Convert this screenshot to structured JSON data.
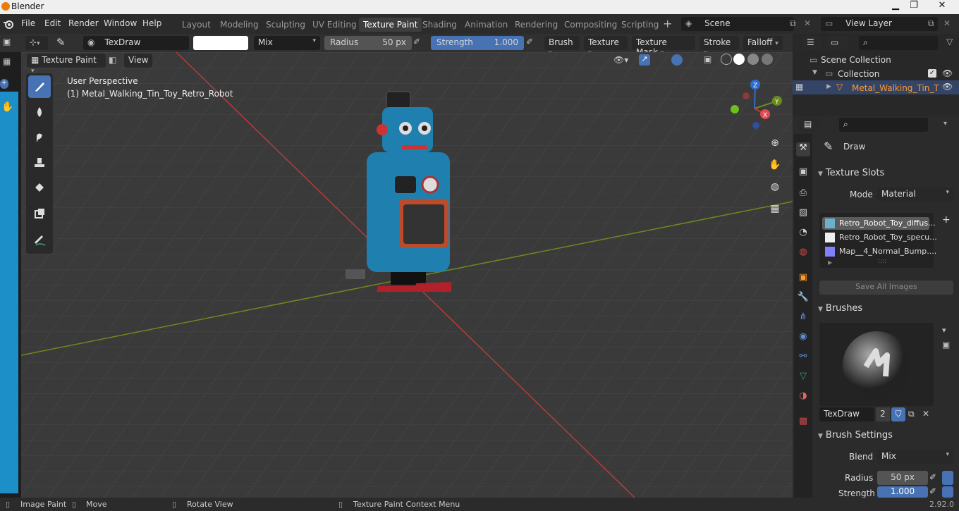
{
  "window": {
    "title": "Blender",
    "minimize": "▁",
    "maximize": "❐",
    "close": "✕"
  },
  "menu": [
    "File",
    "Edit",
    "Render",
    "Window",
    "Help"
  ],
  "workspaces": [
    "Layout",
    "Modeling",
    "Sculpting",
    "UV Editing",
    "Texture Paint",
    "Shading",
    "Animation",
    "Rendering",
    "Compositing",
    "Scripting"
  ],
  "active_workspace": "Texture Paint",
  "scene": {
    "name": "Scene",
    "view_layer": "View Layer"
  },
  "toolheader": {
    "brush_name": "TexDraw",
    "blend": "Mix",
    "radius_label": "Radius",
    "radius_value": "50 px",
    "strength_label": "Strength",
    "strength_value": "1.000",
    "menus": [
      "Brush",
      "Texture",
      "Texture Mask",
      "Stroke",
      "Falloff"
    ]
  },
  "viewport": {
    "mode": "Texture Paint",
    "view_menu": "View",
    "overlay_line1": "User Perspective",
    "overlay_line2": "(1) Metal_Walking_Tin_Toy_Retro_Robot",
    "gizmo": {
      "z": "Z",
      "y": "Y",
      "x": "X"
    }
  },
  "outliner": {
    "root": "Scene Collection",
    "collection": "Collection",
    "object": "Metal_Walking_Tin_T"
  },
  "properties": {
    "tool_name": "Draw",
    "texture_slots": {
      "header": "Texture Slots",
      "mode_label": "Mode",
      "mode_value": "Material",
      "slots": [
        "Retro_Robot_Toy_diffus...",
        "Retro_Robot_Toy_specu...",
        "Map__4_Normal_Bump...."
      ],
      "save_all": "Save All Images"
    },
    "brushes": {
      "header": "Brushes",
      "brush_name": "TexDraw",
      "users": "2"
    },
    "brush_settings": {
      "header": "Brush Settings",
      "blend_label": "Blend",
      "blend_value": "Mix",
      "radius_label": "Radius",
      "radius_value": "50 px",
      "strength_label": "Strength",
      "strength_value": "1.000"
    }
  },
  "statusbar": {
    "left": "Image Paint",
    "middle": "Move",
    "rotate": "Rotate View",
    "context": "Texture Paint Context Menu",
    "version": "2.92.0"
  },
  "colors": {
    "accent": "#4772b3",
    "x_axis": "#b33c3c",
    "y_axis": "#6b8a1e",
    "selection": "#ff9a2e"
  }
}
